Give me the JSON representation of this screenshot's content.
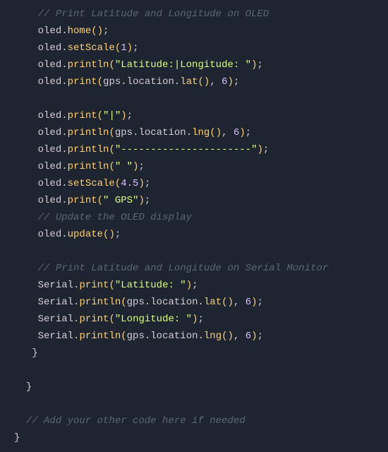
{
  "lines": [
    {
      "indent": "    ",
      "tokens": [
        {
          "t": "// Print Latitude and Longitude on OLED",
          "c": "comment"
        }
      ]
    },
    {
      "indent": "    ",
      "tokens": [
        {
          "t": "oled",
          "c": "obj"
        },
        {
          "t": ".",
          "c": "dot"
        },
        {
          "t": "home",
          "c": "method"
        },
        {
          "t": "()",
          "c": "paren"
        },
        {
          "t": ";",
          "c": "punct"
        }
      ]
    },
    {
      "indent": "    ",
      "tokens": [
        {
          "t": "oled",
          "c": "obj"
        },
        {
          "t": ".",
          "c": "dot"
        },
        {
          "t": "setScale",
          "c": "method"
        },
        {
          "t": "(",
          "c": "paren"
        },
        {
          "t": "1",
          "c": "number"
        },
        {
          "t": ")",
          "c": "paren"
        },
        {
          "t": ";",
          "c": "punct"
        }
      ]
    },
    {
      "indent": "    ",
      "tokens": [
        {
          "t": "oled",
          "c": "obj"
        },
        {
          "t": ".",
          "c": "dot"
        },
        {
          "t": "println",
          "c": "method"
        },
        {
          "t": "(",
          "c": "paren"
        },
        {
          "t": "\"Latitude:|Longitude: \"",
          "c": "string"
        },
        {
          "t": ")",
          "c": "paren"
        },
        {
          "t": ";",
          "c": "punct"
        }
      ]
    },
    {
      "indent": "    ",
      "tokens": [
        {
          "t": "oled",
          "c": "obj"
        },
        {
          "t": ".",
          "c": "dot"
        },
        {
          "t": "print",
          "c": "method"
        },
        {
          "t": "(",
          "c": "paren"
        },
        {
          "t": "gps",
          "c": "obj"
        },
        {
          "t": ".",
          "c": "dot"
        },
        {
          "t": "location",
          "c": "obj"
        },
        {
          "t": ".",
          "c": "dot"
        },
        {
          "t": "lat",
          "c": "method"
        },
        {
          "t": "()",
          "c": "paren"
        },
        {
          "t": ", ",
          "c": "punct"
        },
        {
          "t": "6",
          "c": "number"
        },
        {
          "t": ")",
          "c": "paren"
        },
        {
          "t": ";",
          "c": "punct"
        }
      ]
    },
    {
      "indent": "    ",
      "tokens": [
        {
          "t": " ",
          "c": "ident"
        }
      ]
    },
    {
      "indent": "    ",
      "tokens": [
        {
          "t": "oled",
          "c": "obj"
        },
        {
          "t": ".",
          "c": "dot"
        },
        {
          "t": "print",
          "c": "method"
        },
        {
          "t": "(",
          "c": "paren"
        },
        {
          "t": "\"|\"",
          "c": "string"
        },
        {
          "t": ")",
          "c": "paren"
        },
        {
          "t": ";",
          "c": "punct"
        }
      ]
    },
    {
      "indent": "    ",
      "tokens": [
        {
          "t": "oled",
          "c": "obj"
        },
        {
          "t": ".",
          "c": "dot"
        },
        {
          "t": "println",
          "c": "method"
        },
        {
          "t": "(",
          "c": "paren"
        },
        {
          "t": "gps",
          "c": "obj"
        },
        {
          "t": ".",
          "c": "dot"
        },
        {
          "t": "location",
          "c": "obj"
        },
        {
          "t": ".",
          "c": "dot"
        },
        {
          "t": "lng",
          "c": "method"
        },
        {
          "t": "()",
          "c": "paren"
        },
        {
          "t": ", ",
          "c": "punct"
        },
        {
          "t": "6",
          "c": "number"
        },
        {
          "t": ")",
          "c": "paren"
        },
        {
          "t": ";",
          "c": "punct"
        }
      ]
    },
    {
      "indent": "    ",
      "tokens": [
        {
          "t": "oled",
          "c": "obj"
        },
        {
          "t": ".",
          "c": "dot"
        },
        {
          "t": "println",
          "c": "method"
        },
        {
          "t": "(",
          "c": "paren"
        },
        {
          "t": "\"----------------------\"",
          "c": "string"
        },
        {
          "t": ")",
          "c": "paren"
        },
        {
          "t": ";",
          "c": "punct"
        }
      ]
    },
    {
      "indent": "    ",
      "tokens": [
        {
          "t": "oled",
          "c": "obj"
        },
        {
          "t": ".",
          "c": "dot"
        },
        {
          "t": "println",
          "c": "method"
        },
        {
          "t": "(",
          "c": "paren"
        },
        {
          "t": "\" \"",
          "c": "string"
        },
        {
          "t": ")",
          "c": "paren"
        },
        {
          "t": ";",
          "c": "punct"
        }
      ]
    },
    {
      "indent": "    ",
      "tokens": [
        {
          "t": "oled",
          "c": "obj"
        },
        {
          "t": ".",
          "c": "dot"
        },
        {
          "t": "setScale",
          "c": "method"
        },
        {
          "t": "(",
          "c": "paren"
        },
        {
          "t": "4.5",
          "c": "number"
        },
        {
          "t": ")",
          "c": "paren"
        },
        {
          "t": ";",
          "c": "punct"
        }
      ]
    },
    {
      "indent": "    ",
      "tokens": [
        {
          "t": "oled",
          "c": "obj"
        },
        {
          "t": ".",
          "c": "dot"
        },
        {
          "t": "print",
          "c": "method"
        },
        {
          "t": "(",
          "c": "paren"
        },
        {
          "t": "\" GPS\"",
          "c": "string"
        },
        {
          "t": ")",
          "c": "paren"
        },
        {
          "t": ";",
          "c": "punct"
        }
      ]
    },
    {
      "indent": "    ",
      "tokens": [
        {
          "t": "// Update the OLED display",
          "c": "comment"
        }
      ]
    },
    {
      "indent": "    ",
      "tokens": [
        {
          "t": "oled",
          "c": "obj"
        },
        {
          "t": ".",
          "c": "dot"
        },
        {
          "t": "update",
          "c": "method"
        },
        {
          "t": "()",
          "c": "paren"
        },
        {
          "t": ";",
          "c": "punct"
        }
      ]
    },
    {
      "indent": "    ",
      "tokens": [
        {
          "t": " ",
          "c": "ident"
        }
      ]
    },
    {
      "indent": "    ",
      "tokens": [
        {
          "t": "// Print Latitude and Longitude on Serial Monitor",
          "c": "comment"
        }
      ]
    },
    {
      "indent": "    ",
      "tokens": [
        {
          "t": "Serial",
          "c": "obj"
        },
        {
          "t": ".",
          "c": "dot"
        },
        {
          "t": "print",
          "c": "method"
        },
        {
          "t": "(",
          "c": "paren"
        },
        {
          "t": "\"Latitude: \"",
          "c": "string"
        },
        {
          "t": ")",
          "c": "paren"
        },
        {
          "t": ";",
          "c": "punct"
        }
      ]
    },
    {
      "indent": "    ",
      "tokens": [
        {
          "t": "Serial",
          "c": "obj"
        },
        {
          "t": ".",
          "c": "dot"
        },
        {
          "t": "println",
          "c": "method"
        },
        {
          "t": "(",
          "c": "paren"
        },
        {
          "t": "gps",
          "c": "obj"
        },
        {
          "t": ".",
          "c": "dot"
        },
        {
          "t": "location",
          "c": "obj"
        },
        {
          "t": ".",
          "c": "dot"
        },
        {
          "t": "lat",
          "c": "method"
        },
        {
          "t": "()",
          "c": "paren"
        },
        {
          "t": ", ",
          "c": "punct"
        },
        {
          "t": "6",
          "c": "number"
        },
        {
          "t": ")",
          "c": "paren"
        },
        {
          "t": ";",
          "c": "punct"
        }
      ]
    },
    {
      "indent": "    ",
      "tokens": [
        {
          "t": "Serial",
          "c": "obj"
        },
        {
          "t": ".",
          "c": "dot"
        },
        {
          "t": "print",
          "c": "method"
        },
        {
          "t": "(",
          "c": "paren"
        },
        {
          "t": "\"Longitude: \"",
          "c": "string"
        },
        {
          "t": ")",
          "c": "paren"
        },
        {
          "t": ";",
          "c": "punct"
        }
      ]
    },
    {
      "indent": "    ",
      "tokens": [
        {
          "t": "Serial",
          "c": "obj"
        },
        {
          "t": ".",
          "c": "dot"
        },
        {
          "t": "println",
          "c": "method"
        },
        {
          "t": "(",
          "c": "paren"
        },
        {
          "t": "gps",
          "c": "obj"
        },
        {
          "t": ".",
          "c": "dot"
        },
        {
          "t": "location",
          "c": "obj"
        },
        {
          "t": ".",
          "c": "dot"
        },
        {
          "t": "lng",
          "c": "method"
        },
        {
          "t": "()",
          "c": "paren"
        },
        {
          "t": ", ",
          "c": "punct"
        },
        {
          "t": "6",
          "c": "number"
        },
        {
          "t": ")",
          "c": "paren"
        },
        {
          "t": ";",
          "c": "punct"
        }
      ]
    },
    {
      "indent": "   ",
      "tokens": [
        {
          "t": "}",
          "c": "brace"
        }
      ]
    },
    {
      "indent": "   ",
      "tokens": [
        {
          "t": " ",
          "c": "ident"
        }
      ]
    },
    {
      "indent": "  ",
      "tokens": [
        {
          "t": "}",
          "c": "brace"
        }
      ]
    },
    {
      "indent": "  ",
      "tokens": [
        {
          "t": " ",
          "c": "ident"
        }
      ]
    },
    {
      "indent": "  ",
      "tokens": [
        {
          "t": "// Add your other code here if needed",
          "c": "comment"
        }
      ]
    },
    {
      "indent": "",
      "tokens": [
        {
          "t": "}",
          "c": "brace"
        }
      ]
    }
  ]
}
